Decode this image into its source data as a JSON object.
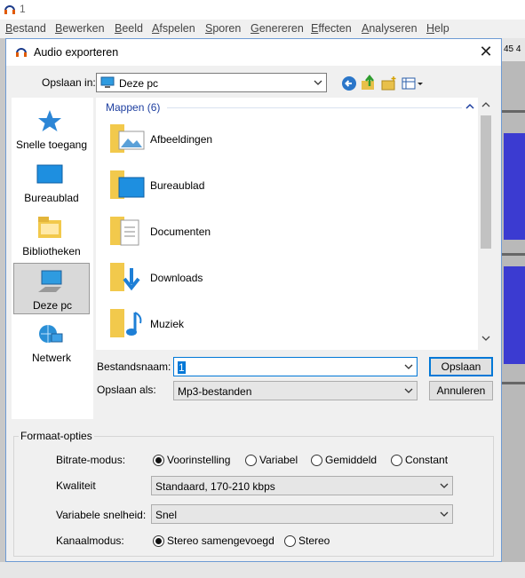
{
  "app": {
    "title": "1"
  },
  "menu": [
    "Bestand",
    "Bewerken",
    "Beeld",
    "Afspelen",
    "Sporen",
    "Genereren",
    "Effecten",
    "Analyseren",
    "Help"
  ],
  "ruler_text": "45  4",
  "dialog": {
    "title": "Audio exporteren",
    "save_in_label": "Opslaan in:",
    "save_in_value": "Deze pc",
    "places": [
      {
        "label": "Snelle toegang",
        "icon": "star-icon"
      },
      {
        "label": "Bureaublad",
        "icon": "desktop-icon"
      },
      {
        "label": "Bibliotheken",
        "icon": "libraries-icon"
      },
      {
        "label": "Deze pc",
        "icon": "computer-icon",
        "selected": true
      },
      {
        "label": "Netwerk",
        "icon": "network-icon"
      }
    ],
    "group_header": "Mappen (6)",
    "folders": [
      "Afbeeldingen",
      "Bureaublad",
      "Documenten",
      "Downloads",
      "Muziek"
    ],
    "filename_label": "Bestandsnaam:",
    "filename_value": "1",
    "saveas_label": "Opslaan als:",
    "saveas_value": "Mp3-bestanden",
    "save_button": "Opslaan",
    "cancel_button": "Annuleren"
  },
  "format_options": {
    "title": "Formaat-opties",
    "bitrate_label": "Bitrate-modus:",
    "bitrate_options": [
      "Voorinstelling",
      "Variabel",
      "Gemiddeld",
      "Constant"
    ],
    "bitrate_selected": "Voorinstelling",
    "quality_label": "Kwaliteit",
    "quality_value": "Standaard, 170-210 kbps",
    "speed_label": "Variabele snelheid:",
    "speed_value": "Snel",
    "channel_label": "Kanaalmodus:",
    "channel_options": [
      "Stereo samengevoegd",
      "Stereo"
    ],
    "channel_selected": "Stereo samengevoegd"
  }
}
